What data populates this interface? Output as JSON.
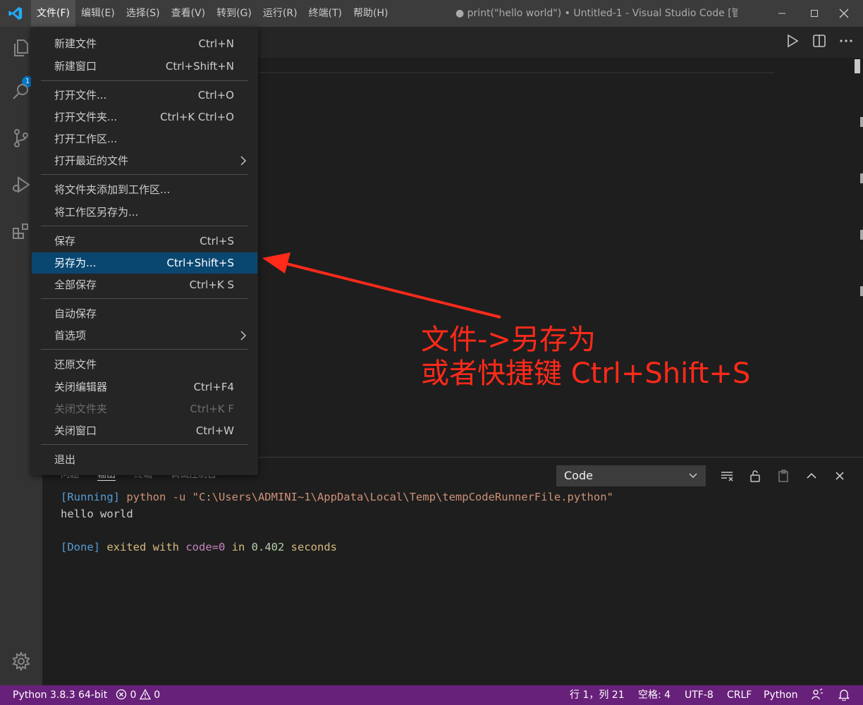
{
  "titlebar": {
    "menus": [
      "文件(F)",
      "编辑(E)",
      "选择(S)",
      "查看(V)",
      "转到(G)",
      "运行(R)",
      "终端(T)",
      "帮助(H)"
    ],
    "window_title": "● print(\"hello world\") • Untitled-1 - Visual Studio Code [管..."
  },
  "activitybar": {
    "explorer_badge": "1"
  },
  "file_menu": {
    "items": [
      {
        "label": "新建文件",
        "shortcut": "Ctrl+N"
      },
      {
        "label": "新建窗口",
        "shortcut": "Ctrl+Shift+N"
      },
      {
        "label": "打开文件...",
        "shortcut": "Ctrl+O"
      },
      {
        "label": "打开文件夹...",
        "shortcut": "Ctrl+K Ctrl+O"
      },
      {
        "label": "打开工作区...",
        "shortcut": ""
      },
      {
        "label": "打开最近的文件",
        "shortcut": ""
      },
      {
        "label": "将文件夹添加到工作区...",
        "shortcut": ""
      },
      {
        "label": "将工作区另存为...",
        "shortcut": ""
      },
      {
        "label": "保存",
        "shortcut": "Ctrl+S"
      },
      {
        "label": "另存为...",
        "shortcut": "Ctrl+Shift+S"
      },
      {
        "label": "全部保存",
        "shortcut": "Ctrl+K S"
      },
      {
        "label": "自动保存",
        "shortcut": ""
      },
      {
        "label": "首选项",
        "shortcut": ""
      },
      {
        "label": "还原文件",
        "shortcut": ""
      },
      {
        "label": "关闭编辑器",
        "shortcut": "Ctrl+F4"
      },
      {
        "label": "关闭文件夹",
        "shortcut": "Ctrl+K F"
      },
      {
        "label": "关闭窗口",
        "shortcut": "Ctrl+W"
      },
      {
        "label": "退出",
        "shortcut": ""
      }
    ]
  },
  "panel": {
    "tabs": [
      "问题",
      "输出",
      "终端",
      "调试控制台"
    ],
    "select_value": "Code",
    "output": {
      "running_tag": "[Running]",
      "command": " python -u \"C:\\Users\\ADMINI~1\\AppData\\Local\\Temp\\tempCodeRunnerFile.python\"",
      "result": "hello world",
      "done_tag": "[Done]",
      "done_exited": " exited with ",
      "done_code": "code=0",
      "done_in": " in ",
      "done_seconds": "0.402",
      "done_unit": " seconds"
    }
  },
  "statusbar": {
    "interpreter": "Python 3.8.3 64-bit",
    "errors": "0",
    "warnings": "0",
    "cursor": "行 1，列 21",
    "spaces": "空格: 4",
    "encoding": "UTF-8",
    "eol": "CRLF",
    "language": "Python"
  },
  "annotation": {
    "line1": "文件->另存为",
    "line2": "或者快捷键 Ctrl+Shift+S"
  },
  "colors": {
    "accent": "#007acc",
    "statusbar": "#68217a",
    "menu_selected": "#094771",
    "annotation": "#ff2a1a"
  }
}
